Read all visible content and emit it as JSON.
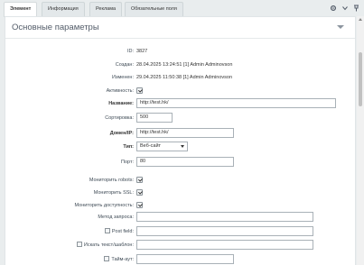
{
  "tabs": [
    {
      "label": "Элемент",
      "active": true
    },
    {
      "label": "Информация",
      "active": false
    },
    {
      "label": "Реклама",
      "active": false
    },
    {
      "label": "Обязательные поля",
      "active": false
    }
  ],
  "section": {
    "title": "Основные параметры"
  },
  "fields": {
    "id": {
      "label": "ID:",
      "value": "3827"
    },
    "created": {
      "label": "Создан:",
      "value": "28.04.2025 13:24:51   [1] Admin Adminovson"
    },
    "modified": {
      "label": "Изменен:",
      "value": "29.04.2025 11:50:38   [1] Admin Adminovson"
    },
    "active": {
      "label": "Активность:",
      "checked": true
    },
    "name": {
      "label": "Название:",
      "value": "http://test.hk/"
    },
    "sort": {
      "label": "Сортировка:",
      "value": "500"
    },
    "domain": {
      "label": "Домен/IP:",
      "value": "http://test.hk/"
    },
    "type": {
      "label": "Тип:",
      "value": "Веб-сайт"
    },
    "port": {
      "label": "Порт:",
      "value": "80"
    },
    "monitor_robots": {
      "label": "Мониторить robots:",
      "checked": true
    },
    "monitor_ssl": {
      "label": "Мониторить SSL:",
      "checked": true
    },
    "monitor_availability": {
      "label": "Мониторить доступность:",
      "checked": true
    },
    "request_method": {
      "label": "Метод запроса:",
      "value": ""
    },
    "post_field": {
      "label": "Post field:",
      "value": ""
    },
    "search_text": {
      "label": "Искать текст/шаблон:",
      "value": ""
    },
    "timeout": {
      "label": "Тайм-аут:",
      "value": ""
    }
  }
}
